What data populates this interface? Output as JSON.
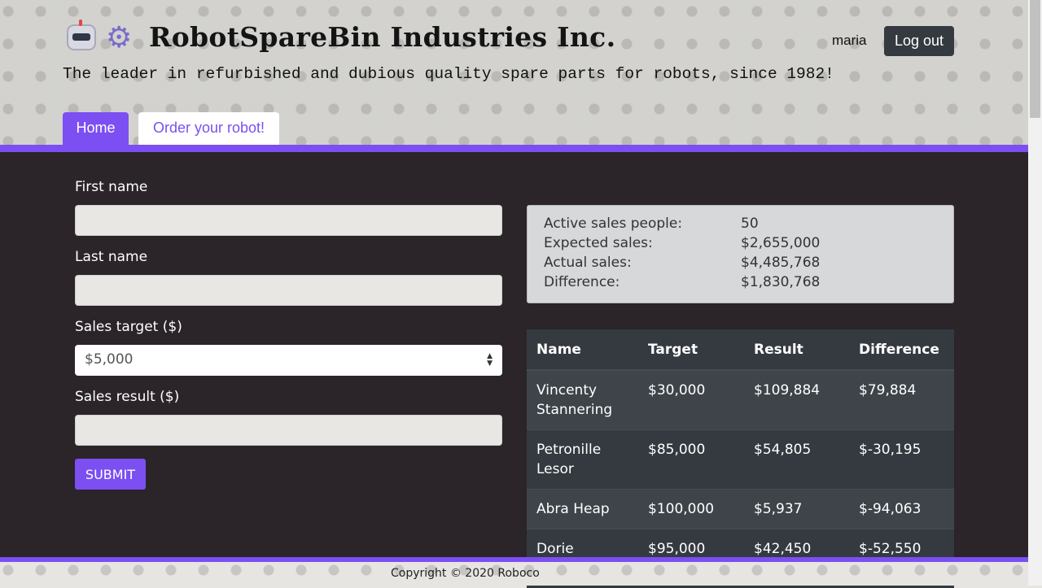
{
  "header": {
    "title": "RobotSpareBin Industries Inc.",
    "tagline": "The leader in refurbished and dubious quality spare parts for robots, since 1982!",
    "username": "maria",
    "logout_label": "Log out",
    "tabs": [
      {
        "label": "Home",
        "active": true
      },
      {
        "label": "Order your robot!",
        "active": false
      }
    ]
  },
  "form": {
    "first_name_label": "First name",
    "first_name_value": "",
    "last_name_label": "Last name",
    "last_name_value": "",
    "sales_target_label": "Sales target ($)",
    "sales_target_selected": "$5,000",
    "sales_result_label": "Sales result ($)",
    "sales_result_value": "",
    "submit_label": "SUBMIT"
  },
  "stats": [
    {
      "label": "Active sales people:",
      "value": "50"
    },
    {
      "label": "Expected sales:",
      "value": "$2,655,000"
    },
    {
      "label": "Actual sales:",
      "value": "$4,485,768"
    },
    {
      "label": "Difference:",
      "value": "$1,830,768"
    }
  ],
  "table": {
    "headers": [
      "Name",
      "Target",
      "Result",
      "Difference"
    ],
    "rows": [
      [
        "Vincenty Stannering",
        "$30,000",
        "$109,884",
        "$79,884"
      ],
      [
        "Petronille Lesor",
        "$85,000",
        "$54,805",
        "$-30,195"
      ],
      [
        "Abra Heap",
        "$100,000",
        "$5,937",
        "$-94,063"
      ],
      [
        "Dorie Batistelli",
        "$95,000",
        "$42,450",
        "$-52,550"
      ]
    ]
  },
  "footer": {
    "copyright": "Copyright © 2020 Roboco"
  },
  "colors": {
    "accent": "#7b4ff2",
    "dark_bg": "#2b2429",
    "button_dark": "#343a40"
  }
}
